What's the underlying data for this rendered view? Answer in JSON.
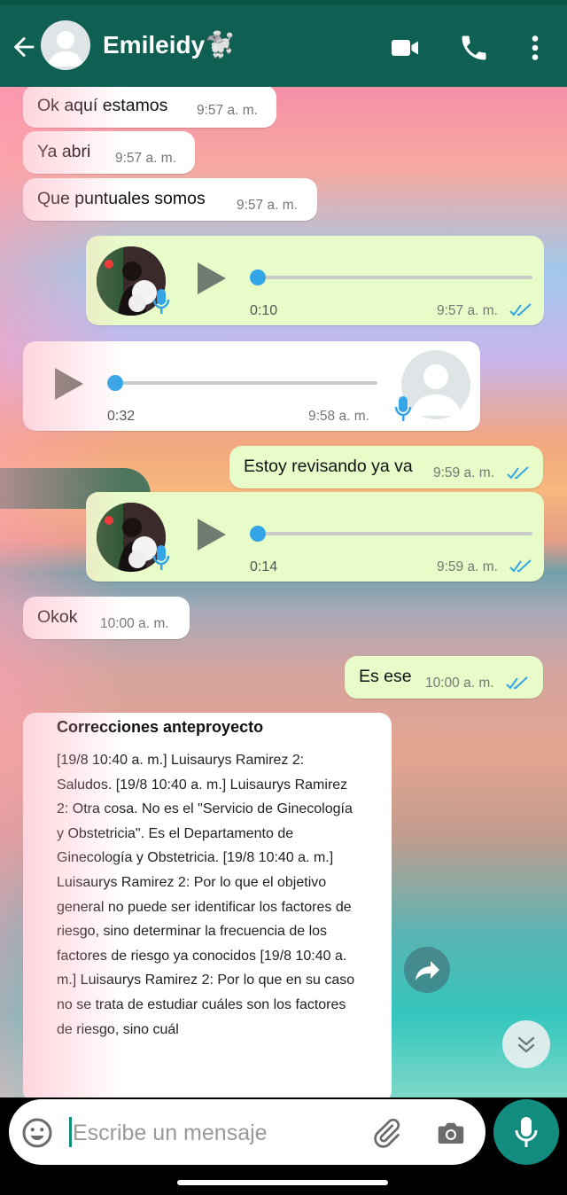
{
  "contact": {
    "name": "Emileidy🐩"
  },
  "messages": {
    "m1": {
      "text": "Ok aquí estamos",
      "time": "9:57 a. m."
    },
    "m2": {
      "text": "Ya abri",
      "time": "9:57 a. m."
    },
    "m3": {
      "text": "Que puntuales somos",
      "time": "9:57 a. m."
    },
    "v1": {
      "duration": "0:10",
      "time": "9:57 a. m.",
      "progress": 0
    },
    "v2": {
      "duration": "0:32",
      "time": "9:58 a. m.",
      "progress": 0
    },
    "m4": {
      "text": "Estoy revisando ya va",
      "time": "9:59 a. m."
    },
    "v3": {
      "duration": "0:14",
      "time": "9:59 a. m.",
      "progress": 0
    },
    "m5": {
      "text": "Okok",
      "time": "10:00 a. m."
    },
    "m6": {
      "text": "Es ese",
      "time": "10:00 a. m."
    }
  },
  "document": {
    "title": "Correcciones anteproyecto",
    "body": "[19/8 10:40 a. m.] Luisaurys Ramirez 2: Saludos. [19/8 10:40 a. m.] Luisaurys Ramirez 2: Otra cosa. No es el \"Servicio de Ginecología y Obstetricia\". Es el Departamento de Ginecología y Obstetricia. [19/8 10:40 a. m.] Luisaurys Ramirez 2: Por lo que el objetivo general no puede ser identificar los factores de riesgo, sino determinar la frecuencia de los factores de riesgo ya conocidos [19/8 10:40 a. m.] Luisaurys Ramirez 2: Por lo que en su caso no se trata de estudiar cuáles son los factores de riesgo, sino cuál"
  },
  "composer": {
    "placeholder": "Escribe un mensaje"
  },
  "icons": {
    "back": "arrow-left-icon",
    "video": "video-camera-icon",
    "call": "phone-icon",
    "menu": "more-vertical-icon",
    "emoji": "emoji-icon",
    "attach": "paperclip-icon",
    "camera": "camera-icon",
    "mic": "microphone-icon",
    "forward": "forward-icon",
    "scroll": "chevron-double-down-icon"
  },
  "colors": {
    "header": "#0f5f52",
    "outgoing": "#e7fcc9",
    "incoming": "#ffffff",
    "accent": "#128c7e",
    "read_ticks": "#34a6e8"
  }
}
